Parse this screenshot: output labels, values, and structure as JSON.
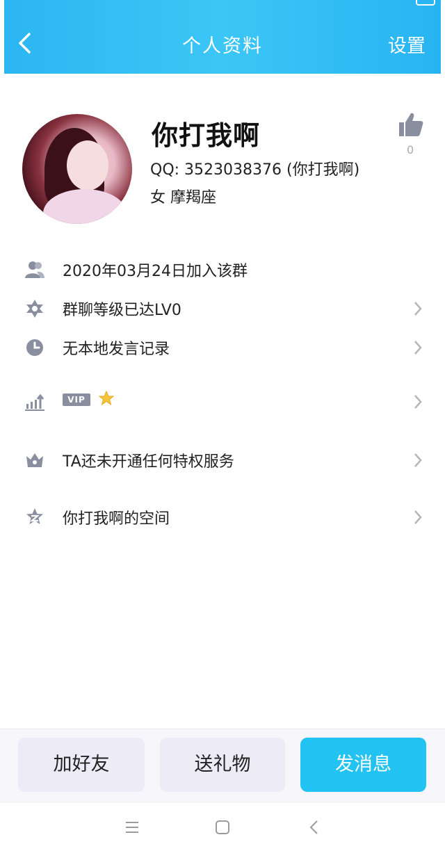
{
  "header": {
    "title": "个人资料",
    "settings_label": "设置"
  },
  "profile": {
    "name": "你打我啊",
    "qq_line": "QQ: 3523038376 (你打我啊)",
    "details": "女  摩羯座",
    "likes": "0"
  },
  "rows": [
    {
      "label": "2020年03月24日加入该群",
      "icon": "group-icon",
      "has_chevron": false
    },
    {
      "label": "群聊等级已达LV0",
      "icon": "star-badge-icon",
      "has_chevron": true
    },
    {
      "label": "无本地发言记录",
      "icon": "clock-icon",
      "has_chevron": true
    },
    {
      "label": "",
      "icon": "chart-icon",
      "has_chevron": true,
      "badge": "VIP"
    },
    {
      "label": "TA还未开通任何特权服务",
      "icon": "crown-icon",
      "has_chevron": true
    },
    {
      "label": "你打我啊的空间",
      "icon": "qzone-star-icon",
      "has_chevron": true
    }
  ],
  "actions": {
    "add_friend": "加好友",
    "send_gift": "送礼物",
    "send_message": "发消息"
  },
  "colors": {
    "accent": "#22c3f2",
    "icon_gray": "#8a8f9f"
  }
}
